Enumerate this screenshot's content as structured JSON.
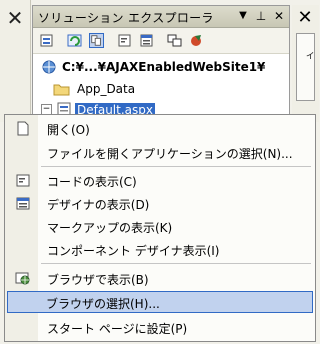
{
  "solution_explorer": {
    "title": "ソリューション エクスプローラ",
    "close_glyph": "✕",
    "pin_glyph": "ﾛ",
    "dropdown_glyph": "▼",
    "tree": {
      "root": "C:¥...¥AJAXEnabledWebSite1¥",
      "items": [
        {
          "label": "App_Data"
        },
        {
          "label": "Default.aspx",
          "selected": true
        }
      ]
    }
  },
  "left_strip": {
    "close_glyph": "✕"
  },
  "properties_tab": {
    "label": "プロパティ",
    "close_glyph": "✕"
  },
  "context_menu": {
    "items": [
      {
        "label": "開く(O)",
        "icon": "open-file-icon"
      },
      {
        "label": "ファイルを開くアプリケーションの選択(N)...",
        "icon": ""
      },
      {
        "label": "コードの表示(C)",
        "icon": "view-code-icon"
      },
      {
        "label": "デザイナの表示(D)",
        "icon": "view-designer-icon"
      },
      {
        "label": "マークアップの表示(K)",
        "icon": ""
      },
      {
        "label": "コンポーネント デザイナ表示(I)",
        "icon": ""
      },
      {
        "label": "ブラウザで表示(B)",
        "icon": "view-in-browser-icon"
      },
      {
        "label": "ブラウザの選択(H)...",
        "icon": "",
        "highlighted": true
      },
      {
        "label": "スタート ページに設定(P)",
        "icon": ""
      }
    ]
  },
  "colors": {
    "selection": "#316ac5",
    "highlight_bg": "#c1d2ee"
  }
}
